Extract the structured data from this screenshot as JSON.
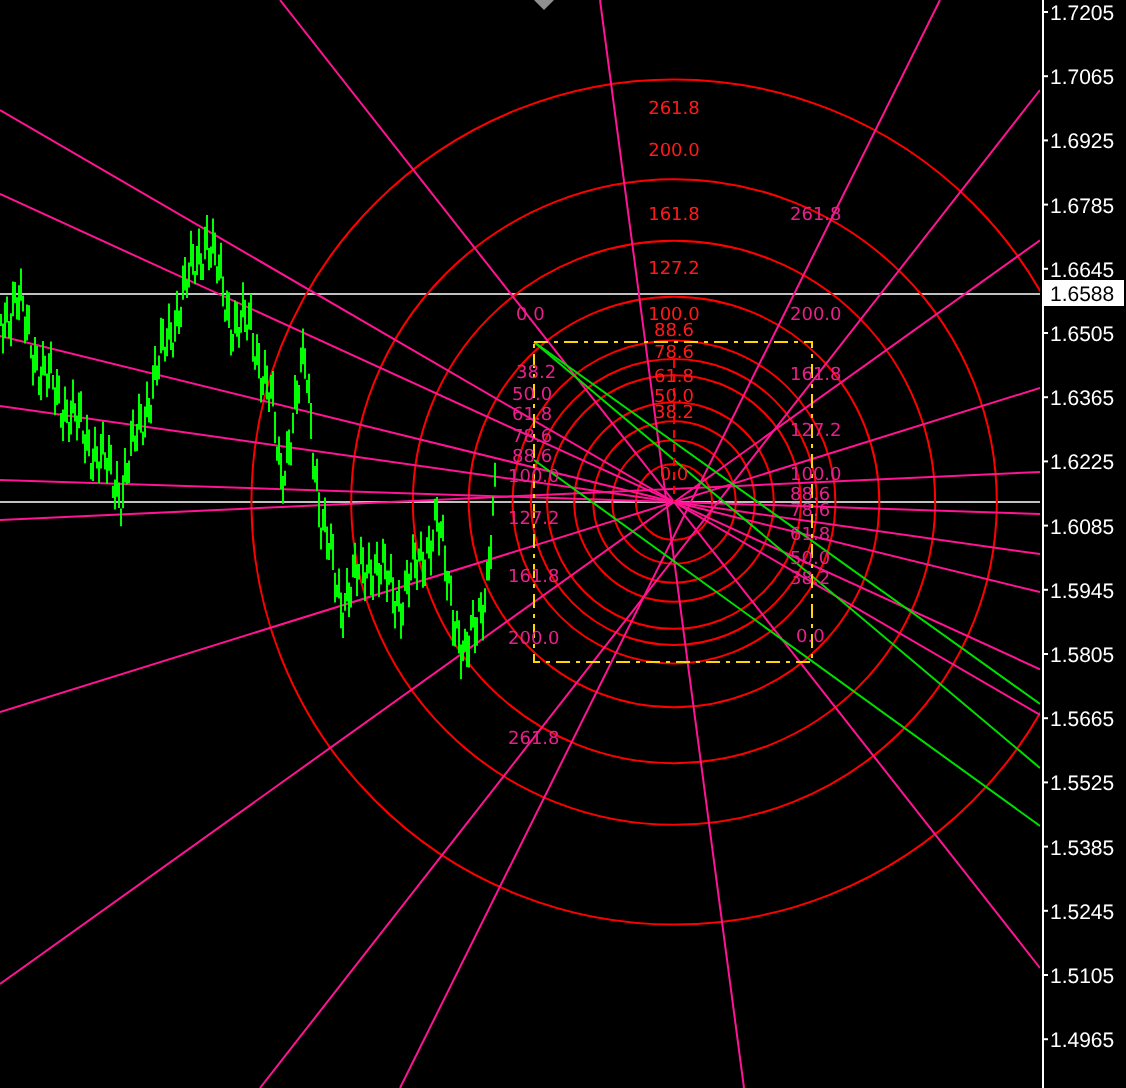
{
  "price_axis": {
    "labels": [
      "1.7205",
      "1.7065",
      "1.6925",
      "1.6785",
      "1.6645",
      "1.6505",
      "1.6365",
      "1.6225",
      "1.6085",
      "1.5945",
      "1.5805",
      "1.5665",
      "1.5525",
      "1.5385",
      "1.5245",
      "1.5105",
      "1.4965"
    ],
    "current_price": "1.6588"
  },
  "fib_circles": {
    "labels": [
      "261.8",
      "200.0",
      "161.8",
      "127.2",
      "100.0",
      "88.6",
      "78.6",
      "61.8",
      "50.0",
      "38.2",
      "0.0"
    ]
  },
  "fib_fan": {
    "left_labels": [
      "0.0",
      "38.2",
      "50.0",
      "61.8",
      "78.6",
      "88.6",
      "100.0",
      "127.2",
      "161.8",
      "200.0",
      "261.8"
    ],
    "right_labels": [
      "261.8",
      "200.0",
      "161.8",
      "127.2",
      "100.0",
      "88.6",
      "78.6",
      "61.8",
      "50.0",
      "38.2",
      "0.0"
    ]
  }
}
